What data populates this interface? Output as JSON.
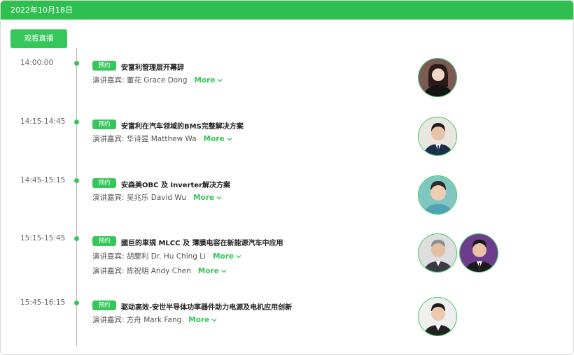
{
  "header": {
    "date": "2022年10月18日"
  },
  "watch_button": "观看直播",
  "sessions": [
    {
      "time": "14:00:00",
      "tag": "预约",
      "title": "安富利管理层开幕辞",
      "speakers": [
        {
          "prefix": "演讲嘉宾:",
          "name": "董花 Grace Dong",
          "more": "More"
        }
      ]
    },
    {
      "time": "14:15-14:45",
      "tag": "预约",
      "title": "安富利在汽车领域的BMS完整解决方案",
      "speakers": [
        {
          "prefix": "演讲嘉宾:",
          "name": "华诗昱 Matthew Wa",
          "more": "More"
        }
      ]
    },
    {
      "time": "14:45-15:15",
      "tag": "预约",
      "title": "安森美OBC 及 Inverter解决方案",
      "speakers": [
        {
          "prefix": "演讲嘉宾:",
          "name": "吴兆乐 David Wu",
          "more": "More"
        }
      ]
    },
    {
      "time": "15:15-15:45",
      "tag": "预约",
      "title": "國巨的車規 MLCC 及 薄膜电容在新能源汽车中应用",
      "speakers": [
        {
          "prefix": "演讲嘉宾:",
          "name": "胡慶利 Dr. Hu Ching Li",
          "more": "More"
        },
        {
          "prefix": "演讲嘉宾:",
          "name": "陈祝明 Andy Chen",
          "more": "More"
        }
      ]
    },
    {
      "time": "15:45-16:15",
      "tag": "预约",
      "title": "驱动高效-安世半导体功率器件助力电源及电机应用创新",
      "speakers": [
        {
          "prefix": "演讲嘉宾:",
          "name": "方舟 Mark Fang",
          "more": "More"
        }
      ]
    }
  ],
  "colors": {
    "accent": "#35c759",
    "header": "#2fbf4e"
  }
}
